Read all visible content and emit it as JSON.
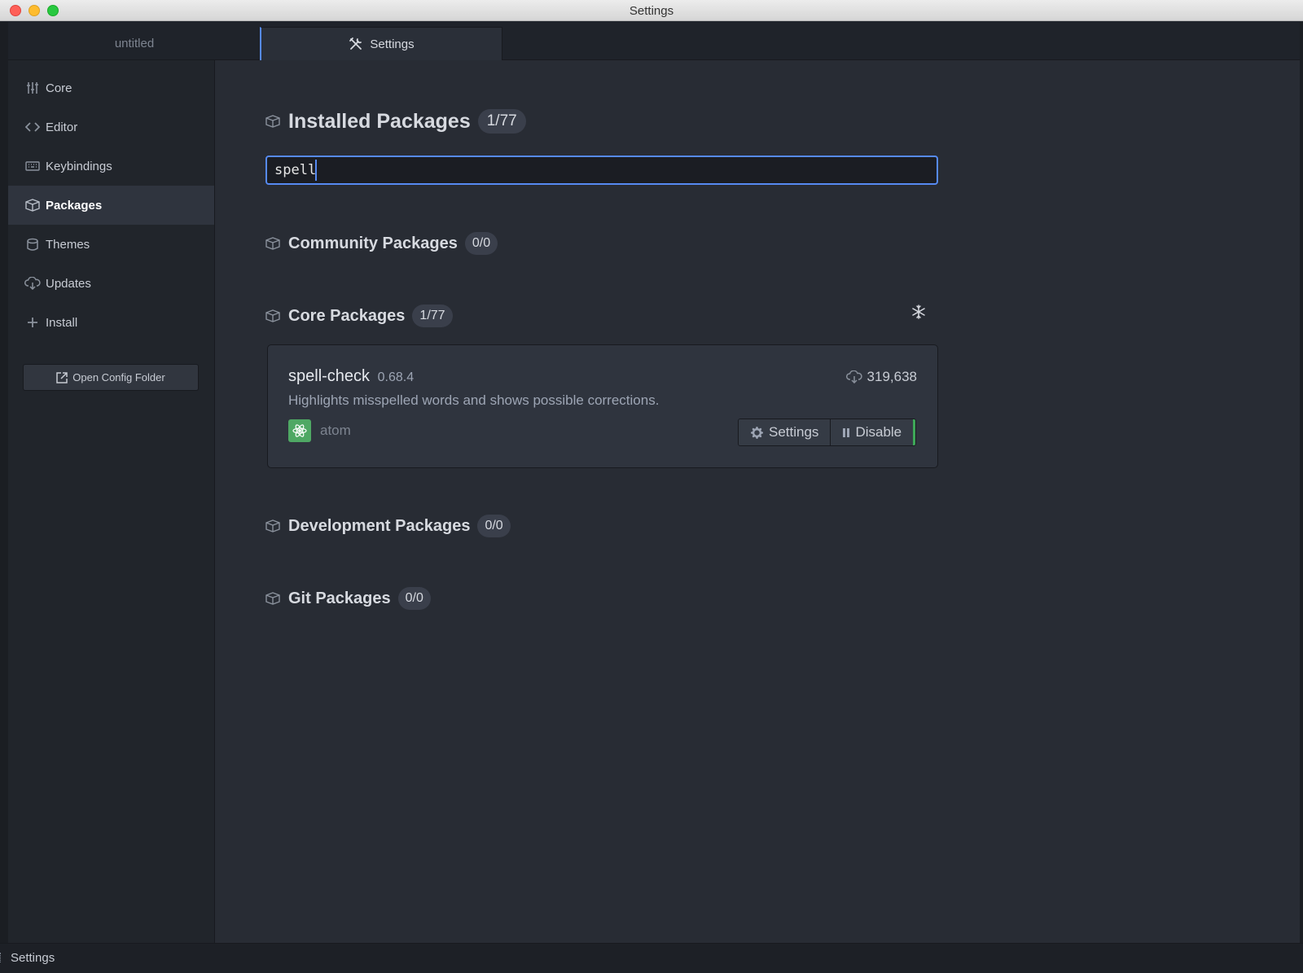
{
  "window": {
    "title": "Settings"
  },
  "tabs": [
    {
      "label": "untitled",
      "active": false
    },
    {
      "label": "Settings",
      "active": true,
      "icon": "tools-icon"
    }
  ],
  "sidebar": {
    "items": [
      {
        "label": "Core",
        "icon": "sliders-icon"
      },
      {
        "label": "Editor",
        "icon": "code-icon"
      },
      {
        "label": "Keybindings",
        "icon": "keyboard-icon"
      },
      {
        "label": "Packages",
        "icon": "package-icon",
        "selected": true
      },
      {
        "label": "Themes",
        "icon": "paintcan-icon"
      },
      {
        "label": "Updates",
        "icon": "cloud-download-icon"
      },
      {
        "label": "Install",
        "icon": "plus-icon"
      }
    ],
    "open_config_label": "Open Config Folder"
  },
  "main": {
    "installed": {
      "title": "Installed Packages",
      "count": "1/77"
    },
    "search": {
      "value": "spell",
      "placeholder": ""
    },
    "community": {
      "title": "Community Packages",
      "count": "0/0"
    },
    "core": {
      "title": "Core Packages",
      "count": "1/77"
    },
    "development": {
      "title": "Development Packages",
      "count": "0/0"
    },
    "git": {
      "title": "Git Packages",
      "count": "0/0"
    },
    "package": {
      "name": "spell-check",
      "version": "0.68.4",
      "downloads": "319,638",
      "description": "Highlights misspelled words and shows possible corrections.",
      "author": "atom",
      "settings_label": "Settings",
      "disable_label": "Disable"
    }
  },
  "statusbar": {
    "text": "Settings"
  },
  "colors": {
    "accent": "#568af2",
    "enabled": "#3ea858",
    "background": "#282c34"
  }
}
